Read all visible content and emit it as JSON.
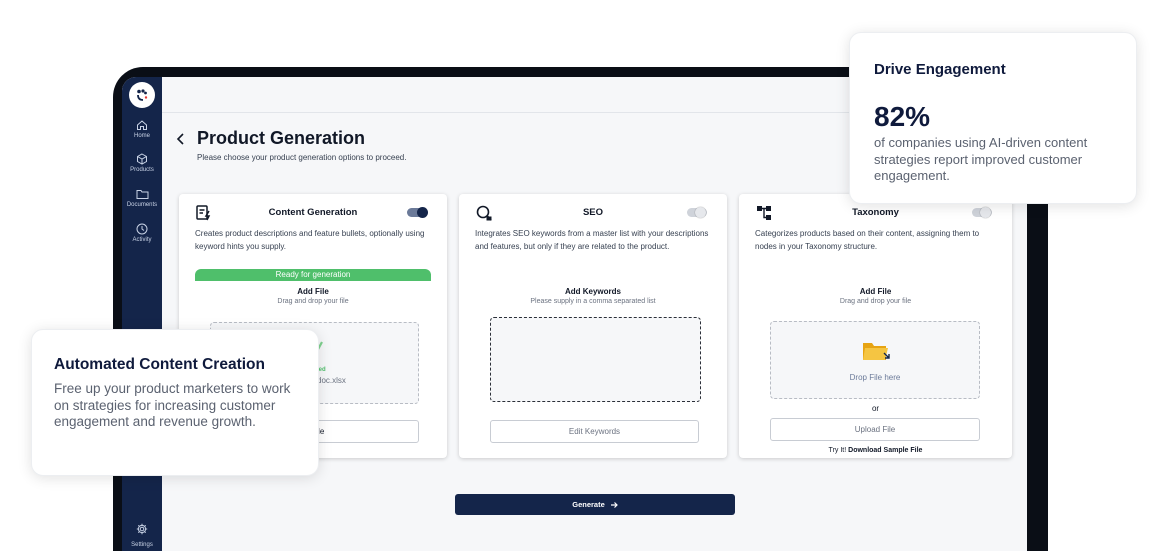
{
  "sidebar": {
    "items": [
      {
        "label": "Home",
        "icon": "home-icon"
      },
      {
        "label": "Products",
        "icon": "cube-icon"
      },
      {
        "label": "Documents",
        "icon": "folder-icon"
      },
      {
        "label": "Activity",
        "icon": "clock-icon"
      }
    ],
    "settings_label": "Settings"
  },
  "page": {
    "title": "Product Generation",
    "subtitle": "Please choose your product generation options to proceed."
  },
  "cards": {
    "content": {
      "title": "Content Generation",
      "toggle_on": true,
      "description": "Creates product descriptions and feature bullets, optionally using keyword hints you supply.",
      "status": "Ready for generation",
      "file_title": "Add File",
      "file_sub": "Drag and drop your file",
      "uploaded_status": "ded",
      "file_name": "doc.xlsx",
      "button": "d File"
    },
    "seo": {
      "title": "SEO",
      "toggle_on": false,
      "description": "Integrates SEO keywords from a master list with your descriptions and features, but only if they are related to the product.",
      "keywords_title": "Add Keywords",
      "keywords_sub": "Please supply in a comma separated list",
      "button": "Edit Keywords"
    },
    "taxonomy": {
      "title": "Taxonomy",
      "toggle_on": false,
      "description": "Categorizes products based on their content, assigning them to nodes in your Taxonomy structure.",
      "file_title": "Add File",
      "file_sub": "Drag and drop your file",
      "drop_text": "Drop File here",
      "or_text": "or",
      "button": "Upload File",
      "try_prefix": "Try It!",
      "try_link": "Download Sample File"
    }
  },
  "generate_button": "Generate",
  "overlay_right": {
    "title": "Drive Engagement",
    "stat": "82%",
    "text": "of companies using AI-driven content strategies report improved customer engagement."
  },
  "overlay_left": {
    "title": "Automated Content Creation",
    "text": "Free up your product marketers to work on strategies for increasing customer engagement and revenue growth."
  },
  "colors": {
    "sidebar": "#14254a",
    "accent": "#14254a",
    "success": "#4fbf6b",
    "folder": "#f5b921"
  }
}
